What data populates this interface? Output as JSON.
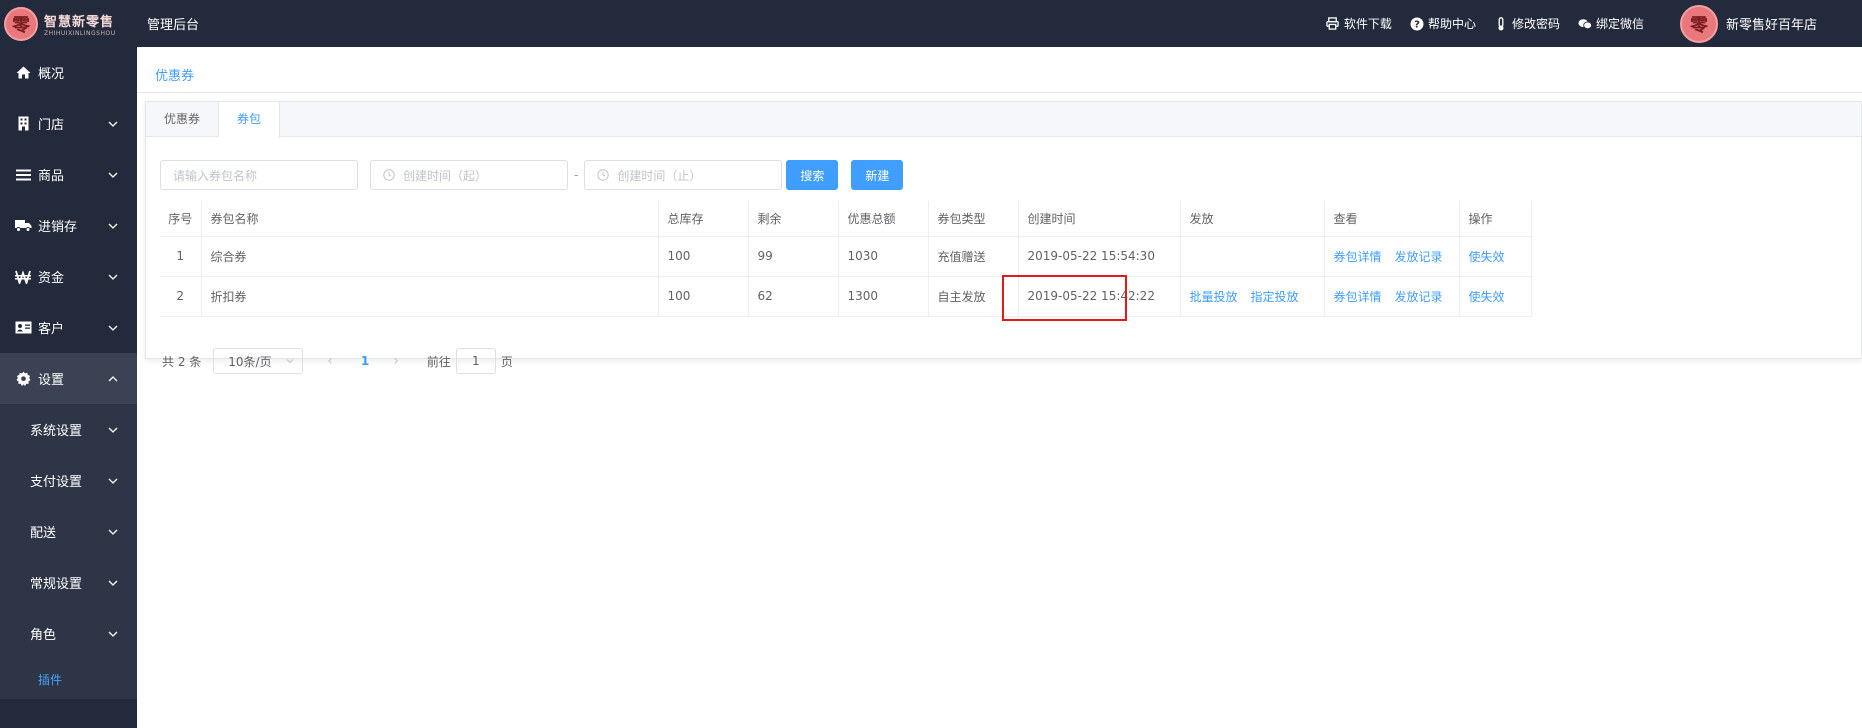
{
  "header": {
    "logo_text": "智慧新零售",
    "logo_sub": "ZHIHUIXINLINGSHOU",
    "logo_glyph": "零",
    "app_title": "管理后台",
    "links": [
      {
        "label": "软件下载",
        "icon": "printer-icon"
      },
      {
        "label": "帮助中心",
        "icon": "question-icon"
      },
      {
        "label": "修改密码",
        "icon": "thermometer-icon"
      },
      {
        "label": "绑定微信",
        "icon": "wechat-icon"
      }
    ],
    "user_name": "新零售好百年店"
  },
  "sidebar": {
    "items": [
      {
        "label": "概况",
        "icon": "home-icon"
      },
      {
        "label": "门店",
        "icon": "building-icon"
      },
      {
        "label": "商品",
        "icon": "list-icon"
      },
      {
        "label": "进销存",
        "icon": "truck-icon"
      },
      {
        "label": "资金",
        "icon": "won-icon"
      },
      {
        "label": "客户",
        "icon": "id-card-icon"
      },
      {
        "label": "设置",
        "icon": "gear-icon"
      }
    ],
    "sub_items": [
      "系统设置",
      "支付设置",
      "配送",
      "常规设置",
      "角色"
    ],
    "plugin_label": "插件"
  },
  "breadcrumb": "优惠券",
  "tabs": [
    {
      "label": "优惠券",
      "active": false
    },
    {
      "label": "券包",
      "active": true
    }
  ],
  "filters": {
    "name_placeholder": "请输入券包名称",
    "start_placeholder": "创建时间（起）",
    "end_placeholder": "创建时间（止）",
    "separator": "-",
    "search_label": "搜索",
    "new_label": "新建"
  },
  "table": {
    "columns": [
      "序号",
      "券包名称",
      "总库存",
      "剩余",
      "优惠总额",
      "券包类型",
      "创建时间",
      "发放",
      "查看",
      "操作"
    ],
    "rows": [
      {
        "index": "1",
        "name": "综合券",
        "stock": "100",
        "remain": "99",
        "total": "1030",
        "type": "充值赠送",
        "created": "2019-05-22 15:54:30",
        "send": [],
        "view": [
          "券包详情",
          "发放记录"
        ],
        "action": "使失效"
      },
      {
        "index": "2",
        "name": "折扣券",
        "stock": "100",
        "remain": "62",
        "total": "1300",
        "type": "自主发放",
        "created": "2019-05-22 15:42:22",
        "send": [
          "批量投放",
          "指定投放"
        ],
        "view": [
          "券包详情",
          "发放记录"
        ],
        "action": "使失效"
      }
    ]
  },
  "pagination": {
    "total_text": "共 2 条",
    "page_size": "10条/页",
    "current_page": "1",
    "goto_label": "前往",
    "goto_value": "1",
    "page_suffix": "页"
  },
  "colors": {
    "dark_bg": "#232a3c",
    "accent": "#409eff",
    "highlight_box": "#e3191b"
  }
}
